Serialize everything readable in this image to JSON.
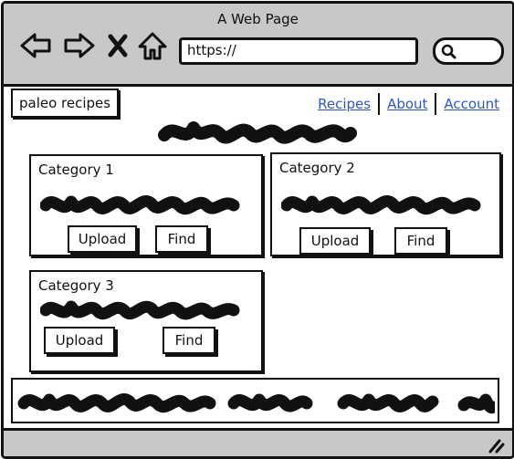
{
  "window": {
    "title": "A Web Page"
  },
  "browser": {
    "url": "https://"
  },
  "site": {
    "logo": "paleo recipes"
  },
  "nav": {
    "links": [
      "Recipes",
      "About",
      "Account"
    ]
  },
  "categories": [
    {
      "title": "Category 1",
      "upload": "Upload",
      "find": "Find"
    },
    {
      "title": "Category 2",
      "upload": "Upload",
      "find": "Find"
    },
    {
      "title": "Category 3",
      "upload": "Upload",
      "find": "Find"
    }
  ]
}
